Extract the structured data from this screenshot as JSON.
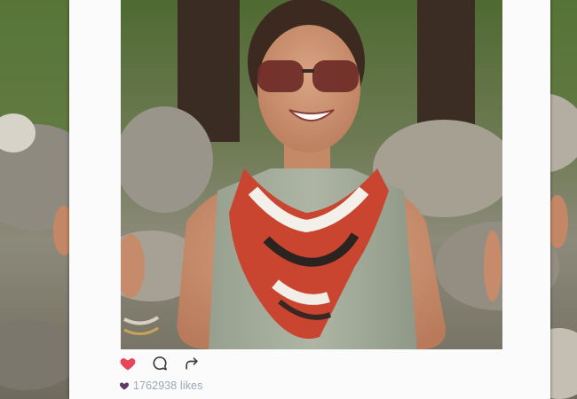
{
  "photo": {
    "subject": "smiling-woman",
    "prop": "instagram-style-frame"
  },
  "frame": {
    "likes_text": "1762938 likes",
    "icons": [
      "heart-icon",
      "comment-icon",
      "share-icon"
    ],
    "heart_color": "#e8455a",
    "mini_heart_color": "#5a3c63",
    "likes_color": "#9aa8b4",
    "icon_color": "#3d3d3d"
  }
}
